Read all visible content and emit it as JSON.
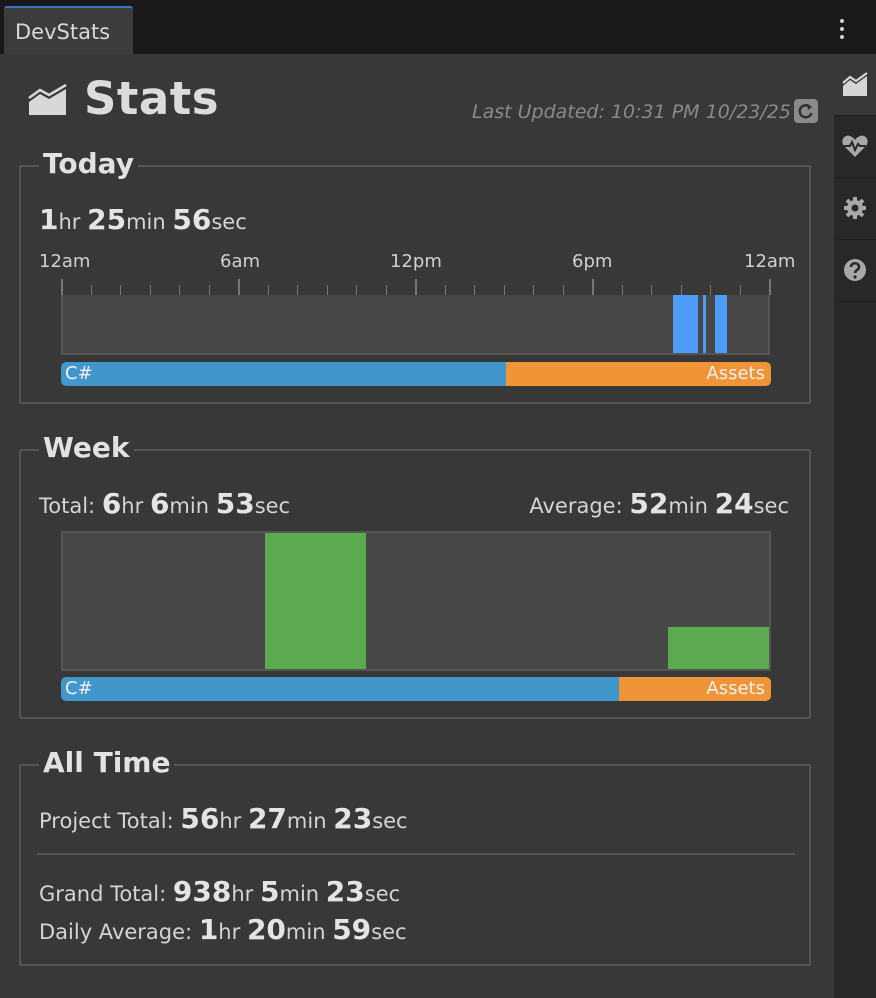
{
  "tab": {
    "label": "DevStats"
  },
  "header": {
    "title": "Stats",
    "last_updated": "Last Updated: 10:31 PM 10/23/25"
  },
  "rail": {
    "buttons": [
      {
        "icon": "chart-area-icon",
        "active": true
      },
      {
        "icon": "heart-pulse-icon",
        "active": false
      },
      {
        "icon": "gear-icon",
        "active": false
      },
      {
        "icon": "help-icon",
        "active": false
      }
    ]
  },
  "today": {
    "title": "Today",
    "total": {
      "hr": "1",
      "min": "25",
      "sec": "56"
    },
    "units": {
      "hr": "hr",
      "min": "min",
      "sec": "sec"
    },
    "axis_labels": [
      "12am",
      "6am",
      "12pm",
      "6pm",
      "12am"
    ],
    "activity_hours": [
      [
        20.75,
        21.6
      ],
      [
        21.8,
        21.9
      ],
      [
        22.2,
        22.6
      ]
    ],
    "activity_color": "#4d9cf8",
    "languages": [
      {
        "label": "C#",
        "fraction": 0.627,
        "color": "#4197cb"
      },
      {
        "label": "Assets",
        "fraction": 0.373,
        "color": "#ef9437"
      }
    ]
  },
  "week": {
    "title": "Week",
    "total_label": "Total:",
    "total": {
      "hr": "6",
      "min": "6",
      "sec": "53"
    },
    "average_label": "Average:",
    "average": {
      "min": "52",
      "sec": "24"
    },
    "day_fractions": [
      0,
      0,
      1.0,
      0,
      0,
      0,
      0.31
    ],
    "bar_color": "#5baa4f",
    "languages": [
      {
        "label": "C#",
        "fraction": 0.786,
        "color": "#4197cb"
      },
      {
        "label": "Assets",
        "fraction": 0.214,
        "color": "#ef9437"
      }
    ]
  },
  "all_time": {
    "title": "All Time",
    "project_label": "Project Total:",
    "project": {
      "hr": "56",
      "min": "27",
      "sec": "23"
    },
    "grand_label": "Grand Total:",
    "grand": {
      "hr": "938",
      "min": "5",
      "sec": "23"
    },
    "daily_label": "Daily Average:",
    "daily": {
      "hr": "1",
      "min": "20",
      "sec": "59"
    }
  }
}
